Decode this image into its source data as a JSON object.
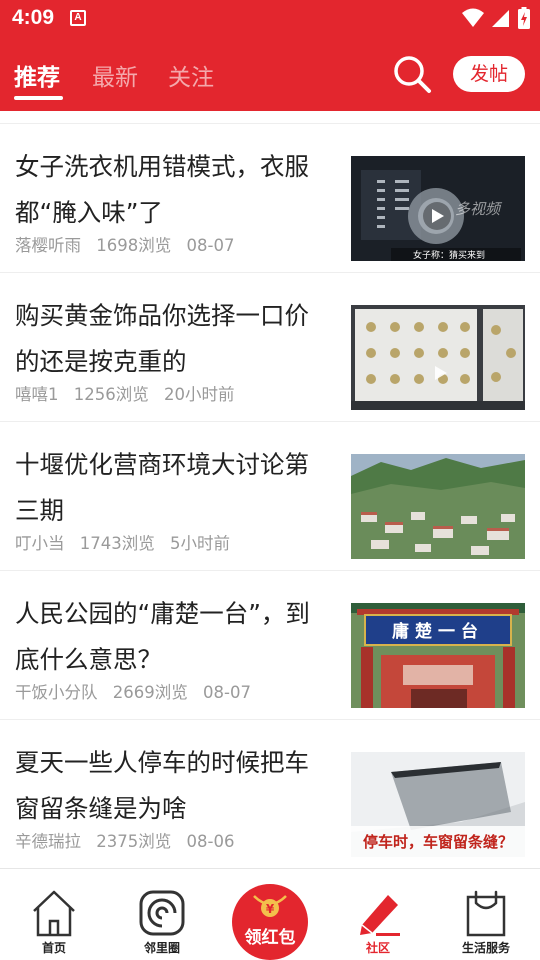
{
  "status_bar": {
    "time": "4:09",
    "notification_glyph": "A",
    "icons": [
      "wifi-icon",
      "signal-icon",
      "battery-icon"
    ]
  },
  "header": {
    "tabs": [
      {
        "label": "推荐",
        "active": true
      },
      {
        "label": "最新",
        "active": false
      },
      {
        "label": "关注",
        "active": false
      }
    ],
    "search_icon": "search-icon",
    "post_label": "发帖"
  },
  "feed": {
    "items": [
      {
        "title": "女子洗衣机用错模式，衣服都“腌入味”了",
        "author": "落樱听雨",
        "views": "1698浏览",
        "time": "08-07",
        "thumb_overlay": "女子称：猜买来到"
      },
      {
        "title": "购买黄金饰品你选择一口价的还是按克重的",
        "author": "嘻嘻1",
        "views": "1256浏览",
        "time": "20小时前"
      },
      {
        "title": "十堰优化营商环境大讨论第三期",
        "author": "叮小当",
        "views": "1743浏览",
        "time": "5小时前"
      },
      {
        "title": "人民公园的“庸楚一台”，到底什么意思？",
        "author": "干饭小分队",
        "views": "2669浏览",
        "time": "08-07",
        "thumb_sign": "庸楚一台"
      },
      {
        "title": "夏天一些人停车的时候把车窗留条缝是为啥",
        "author": "辛德瑞拉",
        "views": "2375浏览",
        "time": "08-06",
        "thumb_caption": "停车时，车窗留条缝？"
      }
    ]
  },
  "bottom_nav": {
    "items": [
      {
        "label": "首页",
        "icon": "home-icon"
      },
      {
        "label": "邻里圈",
        "icon": "neighborhood-icon"
      },
      {
        "label": "社区",
        "icon": "pencil-icon",
        "active": true
      },
      {
        "label": "生活服务",
        "icon": "shopping-bag-icon"
      }
    ],
    "redpacket_label": "领红包",
    "redpacket_glyph": "¥"
  },
  "colors": {
    "brand_red": "#e3262e",
    "meta_gray": "#9a9a9a",
    "title_text": "#222222"
  }
}
